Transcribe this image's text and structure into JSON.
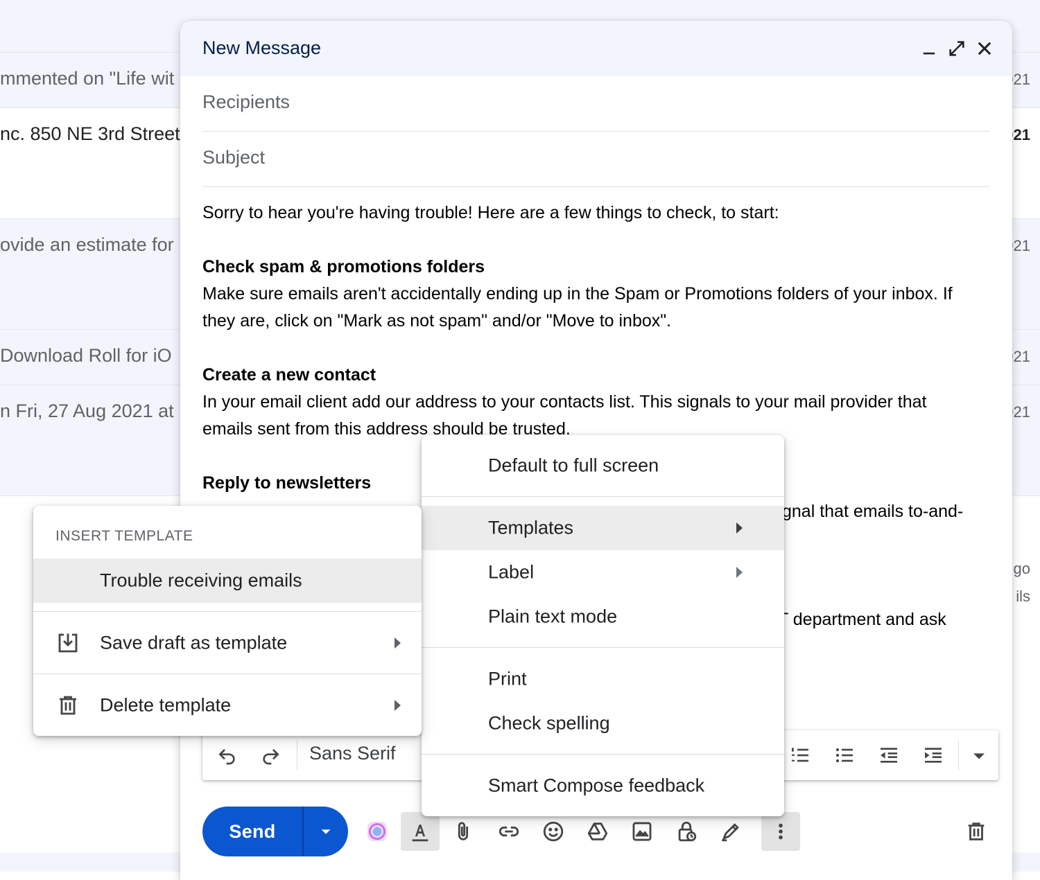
{
  "inbox": {
    "rows": [
      {
        "snippet": "mmented on \"Life wit",
        "date": "021"
      },
      {
        "snippet": "nc. 850 NE 3rd Street",
        "date": "021"
      },
      {
        "snippet": "ovide an estimate for",
        "date": "021"
      },
      {
        "snippet": "Download Roll for iO",
        "date": "021"
      },
      {
        "snippet": "n Fri, 27 Aug 2021 at",
        "date": "021"
      }
    ],
    "side_fragments": [
      "go",
      "ils"
    ]
  },
  "compose": {
    "title": "New Message",
    "recipients_placeholder": "Recipients",
    "subject_placeholder": "Subject",
    "body": {
      "intro": "Sorry to hear you're having trouble! Here are a few things to check, to start:",
      "section1_title": "Check spam & promotions folders",
      "section1_line1": "Make sure emails aren't accidentally ending up in the Spam or Promotions folders of your inbox. If",
      "section1_line2": "they are, click on \"Mark as not spam\" and/or \"Move to inbox\".",
      "section2_title": "Create a new contact",
      "section2_line1": "In your email client add our address to your contacts list. This signals to your mail provider that",
      "section2_line2": "emails sent from this address should be trusted.",
      "section3_title": "Reply to newsletters",
      "section3_partial": "gnal that emails to-and-",
      "section4_partial": "T department and ask"
    },
    "toolbar": {
      "font": "Sans Serif"
    },
    "send_label": "Send"
  },
  "more_menu": {
    "items": [
      {
        "label": "Default to full screen"
      },
      {
        "label": "Templates"
      },
      {
        "label": "Label"
      },
      {
        "label": "Plain text mode"
      },
      {
        "label": "Print"
      },
      {
        "label": "Check spelling"
      },
      {
        "label": "Smart Compose feedback"
      }
    ]
  },
  "template_menu": {
    "header": "INSERT TEMPLATE",
    "items": [
      {
        "label": "Trouble receiving emails"
      },
      {
        "label": "Save draft as template"
      },
      {
        "label": "Delete template"
      }
    ]
  },
  "colors": {
    "accent": "#0b57d0",
    "header_bg": "#f2f6fc",
    "highlight": "#ececec"
  }
}
